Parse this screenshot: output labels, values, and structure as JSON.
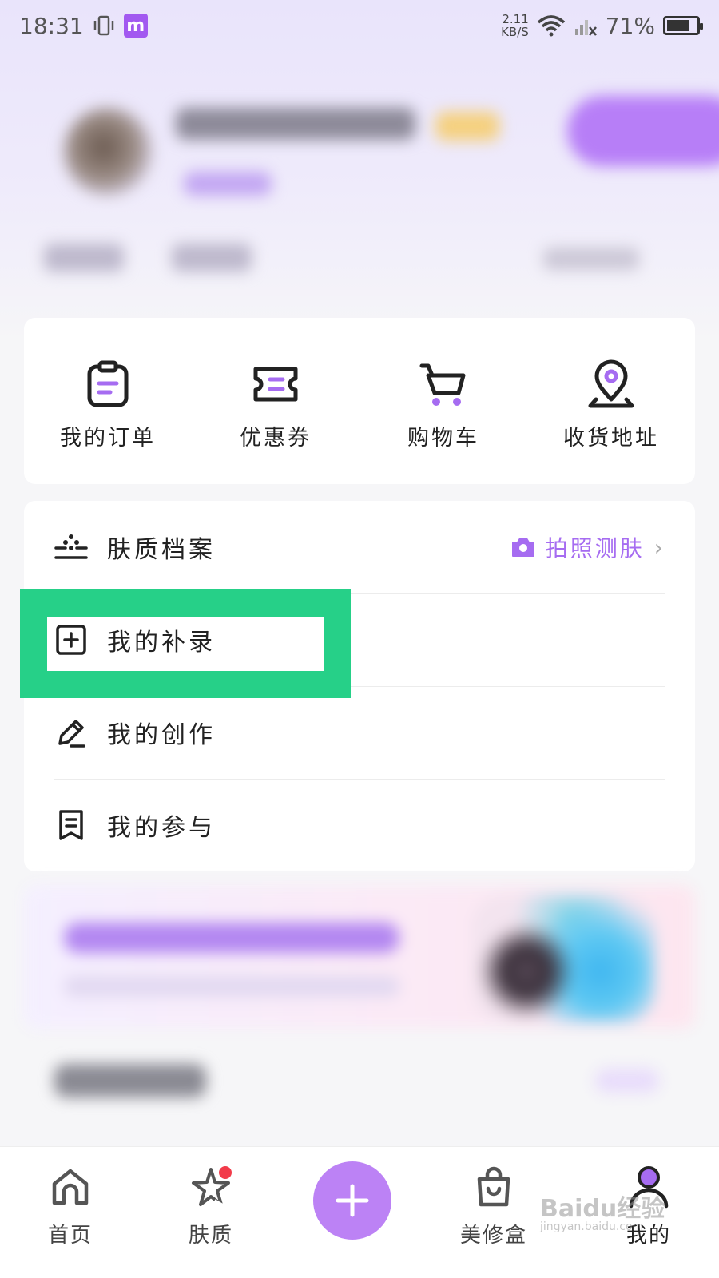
{
  "status_bar": {
    "time": "18:31",
    "net_speed_value": "2.11",
    "net_speed_unit": "KB/S",
    "battery": "71%",
    "app_badge": "m"
  },
  "quick_actions": [
    {
      "label": "我的订单",
      "icon": "clipboard-icon"
    },
    {
      "label": "优惠券",
      "icon": "coupon-icon"
    },
    {
      "label": "购物车",
      "icon": "cart-icon"
    },
    {
      "label": "收货地址",
      "icon": "location-pin-icon"
    }
  ],
  "menu": {
    "skin_profile": {
      "label": "肤质档案",
      "action_label": "拍照测肤"
    },
    "my_records": {
      "label": "我的补录"
    },
    "my_creations": {
      "label": "我的创作"
    },
    "my_participation": {
      "label": "我的参与"
    }
  },
  "bottom_nav": {
    "home": "首页",
    "skin": "肤质",
    "beauty_box": "美修盒",
    "mine": "我的"
  },
  "watermark": {
    "brand": "Baidu经验",
    "url": "jingyan.baidu.com"
  },
  "colors": {
    "accent": "#a66cf1",
    "highlight": "#26d088",
    "plus_button": "#bc82f5",
    "badge_red": "#f23b4a"
  }
}
